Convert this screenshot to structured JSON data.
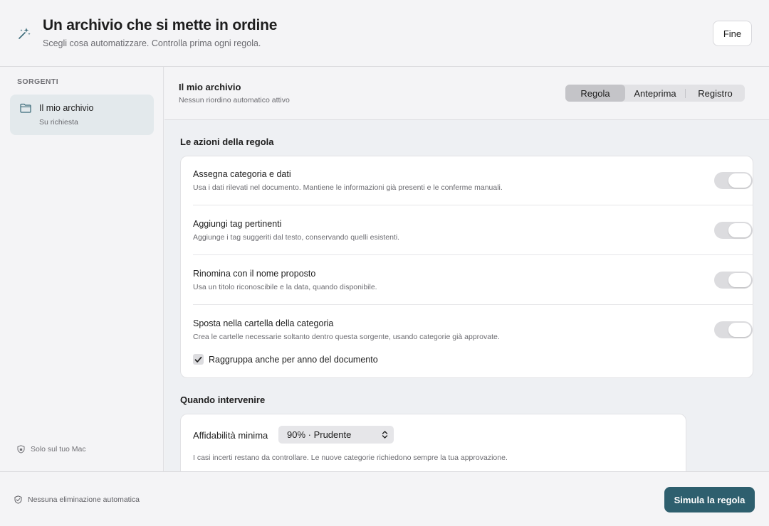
{
  "header": {
    "icon": "magic-wand-icon",
    "title": "Un archivio che si mette in ordine",
    "subtitle": "Scegli cosa automatizzare. Controlla prima ogni regola.",
    "done_label": "Fine"
  },
  "sidebar": {
    "section_label": "SORGENTI",
    "sources": [
      {
        "icon": "folder-icon",
        "name": "Il mio archivio",
        "schedule": "Su richiesta",
        "selected": true
      }
    ],
    "privacy_note": "Solo sul tuo Mac",
    "privacy_icon": "shield-icon"
  },
  "main": {
    "source_title": "Il mio archivio",
    "source_status": "Nessun riordino automatico attivo",
    "tabs": [
      {
        "label": "Regola",
        "active": true
      },
      {
        "label": "Anteprima",
        "active": false
      },
      {
        "label": "Registro",
        "active": false
      }
    ],
    "actions_heading": "Le azioni della regola",
    "actions": [
      {
        "title": "Assegna categoria e dati",
        "desc": "Usa i dati rilevati nel documento. Mantiene le informazioni già presenti e le conferme manuali."
      },
      {
        "title": "Aggiungi tag pertinenti",
        "desc": "Aggiunge i tag suggeriti dal testo, conservando quelli esistenti."
      },
      {
        "title": "Rinomina con il nome proposto",
        "desc": "Usa un titolo riconoscibile e la data, quando disponibile."
      },
      {
        "title": "Sposta nella cartella della categoria",
        "desc": "Crea le cartelle necessarie soltanto dentro questa sorgente, usando categorie già approvate."
      }
    ],
    "group_by_year": {
      "label": "Raggruppa anche per anno del documento",
      "checked": true
    },
    "when_heading": "Quando intervenire",
    "confidence_label": "Affidabilità minima",
    "confidence_value": "90% · Prudente",
    "confidence_note": "I casi incerti restano da controllare. Le nuove categorie richiedono sempre la tua approvazione."
  },
  "footer": {
    "note": "Nessuna eliminazione automatica",
    "note_icon": "shield-check-icon",
    "simulate_label": "Simula la regola"
  },
  "colors": {
    "accent": "#2e5f6e",
    "selected_bg": "#e3e9ec",
    "toggle_off": "#dcdcdf"
  }
}
